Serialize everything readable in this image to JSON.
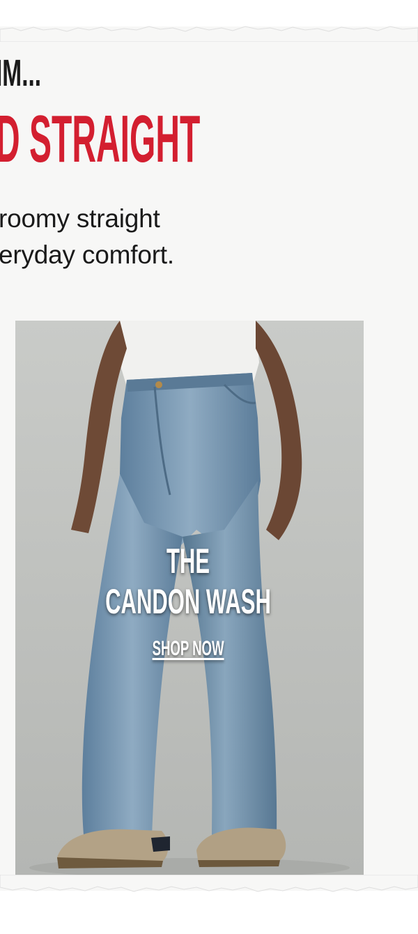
{
  "header": {
    "headline_line1": "IM...",
    "headline_line2": "D STRAIGHT"
  },
  "body_copy": {
    "line1": "roomy straight",
    "line2": "eryday comfort."
  },
  "product": {
    "title_line1": "THE",
    "title_line2": "CANDON WASH",
    "cta_label": "SHOP NOW",
    "image_icon": "model-wearing-straight-jeans-photo"
  },
  "colors": {
    "accent_red": "#d31f30",
    "headline_black": "#1b1b1b",
    "paper": "#f7f7f6",
    "photo_background": "#c7c9c6",
    "denim": "#6d8fad"
  }
}
